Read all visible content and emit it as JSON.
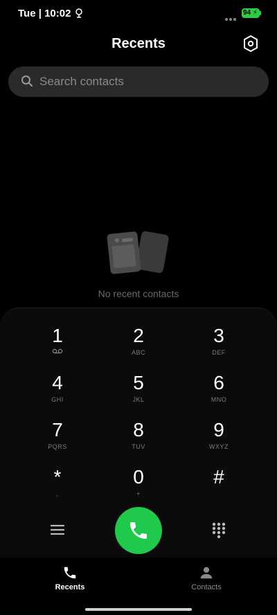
{
  "status_bar": {
    "time": "Tue | 10:02",
    "battery_level": "94"
  },
  "header": {
    "title": "Recents",
    "settings_icon": "settings-hexagon-icon"
  },
  "search": {
    "placeholder": "Search contacts"
  },
  "empty_state": {
    "message": "No recent contacts"
  },
  "dialpad": {
    "keys": [
      {
        "digit": "1",
        "letters": ""
      },
      {
        "digit": "2",
        "letters": "ABC"
      },
      {
        "digit": "3",
        "letters": "DEF"
      },
      {
        "digit": "4",
        "letters": "GHI"
      },
      {
        "digit": "5",
        "letters": "JKL"
      },
      {
        "digit": "6",
        "letters": "MNO"
      },
      {
        "digit": "7",
        "letters": "PQRS"
      },
      {
        "digit": "8",
        "letters": "TUV"
      },
      {
        "digit": "9",
        "letters": "WXYZ"
      },
      {
        "digit": "*",
        "letters": ","
      },
      {
        "digit": "0",
        "letters": "+"
      },
      {
        "digit": "#",
        "letters": ""
      }
    ]
  },
  "bottom_nav": {
    "recents_label": "Recents",
    "contacts_label": "Contacts"
  },
  "colors": {
    "background": "#000000",
    "call_button": "#1fc94c",
    "battery": "#2ecc40",
    "search_bg": "#2a2a2a"
  }
}
